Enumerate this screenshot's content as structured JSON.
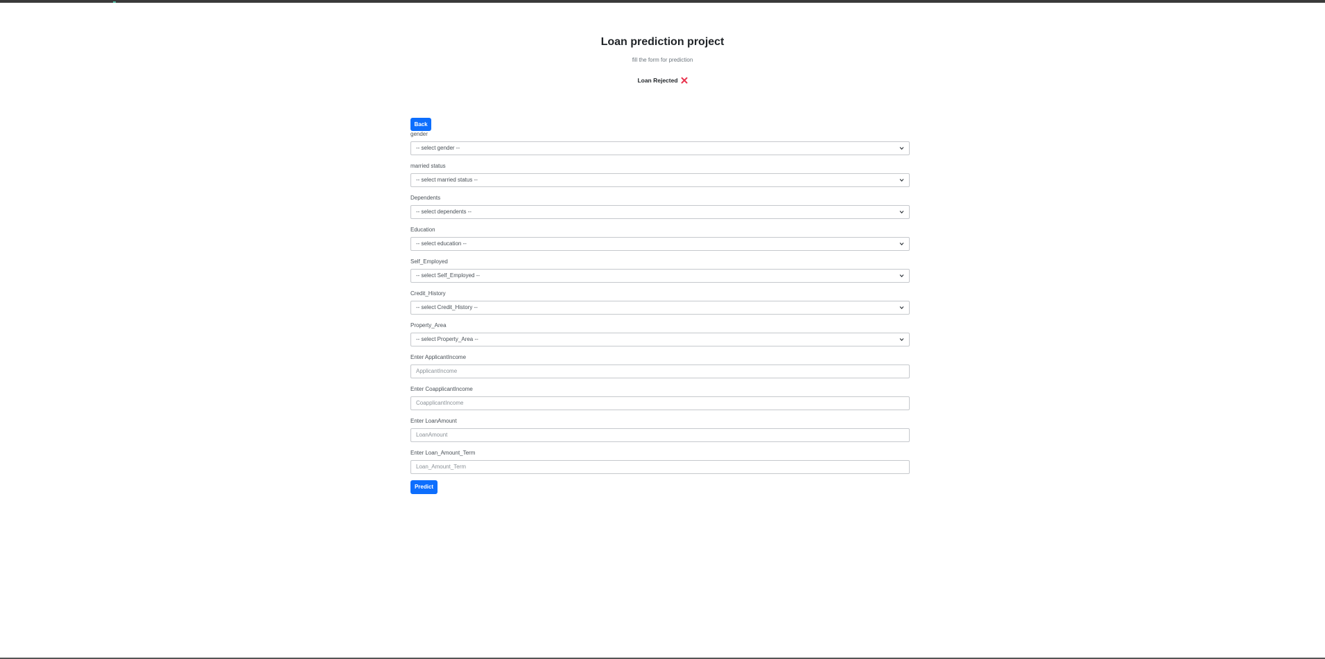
{
  "header": {
    "title": "Loan prediction project",
    "subtitle": "fill the form for prediction",
    "result_text": "Loan Rejected",
    "result_icon": "x-mark-icon",
    "result_icon_color": "#e8344e"
  },
  "accent_color": "#0d6efd",
  "form": {
    "back_label": "Back",
    "selects": [
      {
        "label": "gender",
        "value": "-- select gender --"
      },
      {
        "label": "married status",
        "value": "-- select married status --"
      },
      {
        "label": "Dependents",
        "value": "-- select dependents --"
      },
      {
        "label": "Education",
        "value": "-- select education --"
      },
      {
        "label": "Self_Employed",
        "value": "-- select Self_Employed --"
      },
      {
        "label": "Credit_History",
        "value": "-- select Credit_History --"
      },
      {
        "label": "Property_Area",
        "value": "-- select Property_Area --"
      }
    ],
    "inputs": [
      {
        "label": "Enter ApplicantIncome",
        "placeholder": "ApplicantIncome"
      },
      {
        "label": "Enter CoapplicantIncome",
        "placeholder": "CoapplicantIncome"
      },
      {
        "label": "Enter LoanAmount",
        "placeholder": "LoanAmount"
      },
      {
        "label": "Enter Loan_Amount_Term",
        "placeholder": "Loan_Amount_Term"
      }
    ],
    "predict_label": "Predict"
  }
}
